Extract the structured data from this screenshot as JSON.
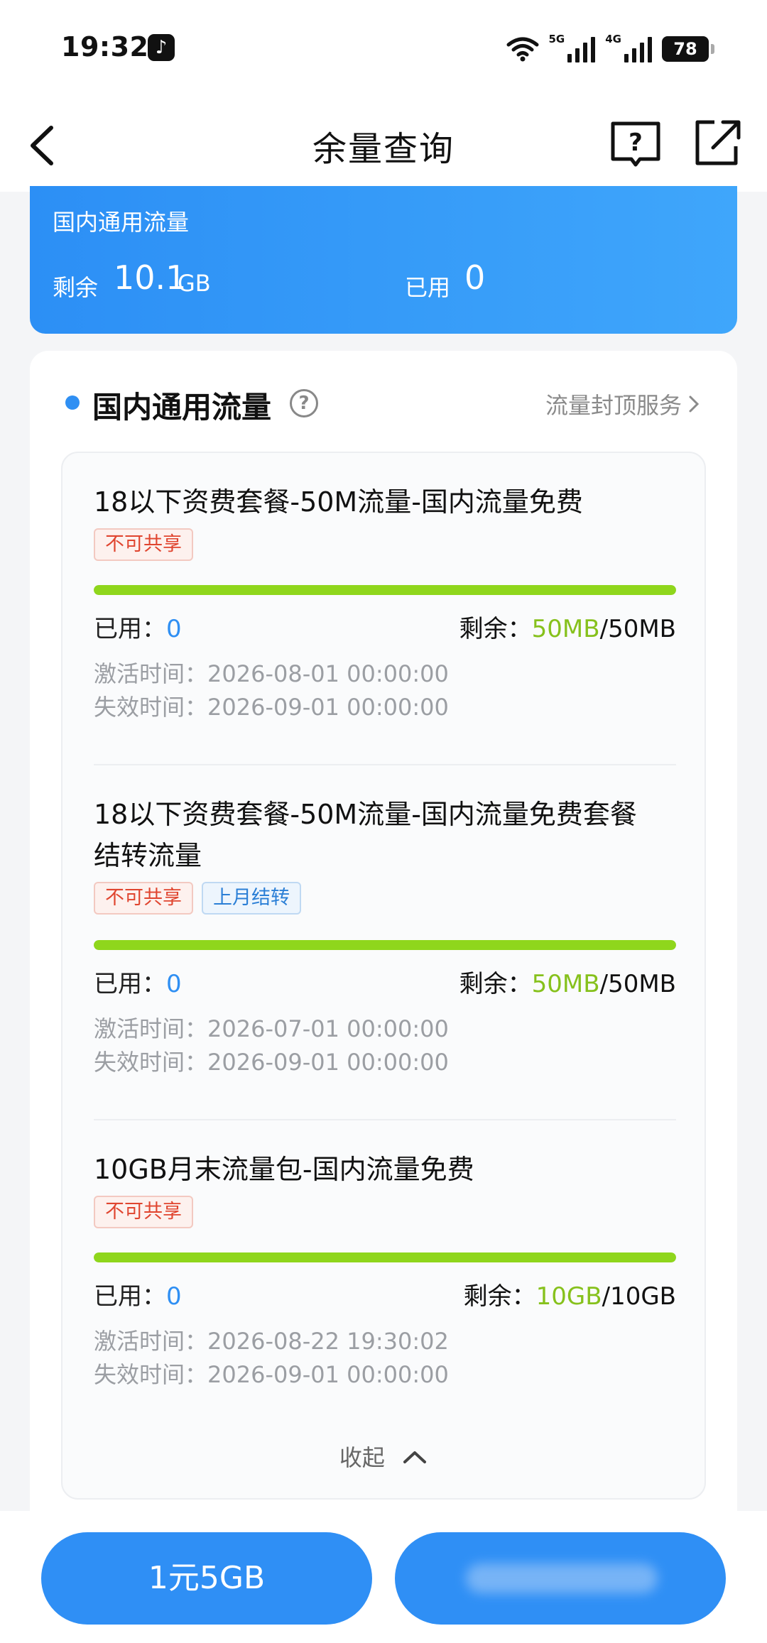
{
  "status_bar": {
    "time": "19:32",
    "net_5g": "5G",
    "net_4g": "4G",
    "battery": "78"
  },
  "nav": {
    "title": "余量查询"
  },
  "summary": {
    "title": "国内通用流量",
    "remain_label": "剩余",
    "remain_value": "10.1",
    "remain_unit": "GB",
    "used_label": "已用",
    "used_value": "0"
  },
  "section": {
    "title": "国内通用流量",
    "link": "流量封顶服务",
    "collapse_label": "收起"
  },
  "items": [
    {
      "title_line1": "18以下资费套餐-50M流量-国内流量免费",
      "tag1": "不可共享",
      "used_label": "已用：",
      "used_value": "0",
      "remain_label": "剩余：",
      "remain_value": "50MB",
      "total": "/50MB",
      "progress": 1.0,
      "activate_label": "激活时间：",
      "activate_time": "2026-08-01 00:00:00",
      "expire_label": "失效时间：",
      "expire_time": "2026-09-01 00:00:00"
    },
    {
      "title_line1": "18以下资费套餐-50M流量-国内流量免费套餐",
      "title_line2": "结转流量",
      "tag1": "不可共享",
      "tag2": "上月结转",
      "used_label": "已用：",
      "used_value": "0",
      "remain_label": "剩余：",
      "remain_value": "50MB",
      "total": "/50MB",
      "progress": 1.0,
      "activate_label": "激活时间：",
      "activate_time": "2026-07-01 00:00:00",
      "expire_label": "失效时间：",
      "expire_time": "2026-09-01 00:00:00"
    },
    {
      "title_line1": "10GB月末流量包-国内流量免费",
      "tag1": "不可共享",
      "used_label": "已用：",
      "used_value": "0",
      "remain_label": "剩余：",
      "remain_value": "10GB",
      "total": "/10GB",
      "progress": 1.0,
      "activate_label": "激活时间：",
      "activate_time": "2026-08-22 19:30:02",
      "expire_label": "失效时间：",
      "expire_time": "2026-09-01 00:00:00"
    }
  ],
  "bottom": {
    "left_button": "1元5GB"
  },
  "colors": {
    "accent": "#2f8ff5",
    "remain": "#86c11c",
    "progress": "#8fd61c",
    "tag_red": "#e0452f",
    "tag_blue": "#2b7fd6"
  }
}
